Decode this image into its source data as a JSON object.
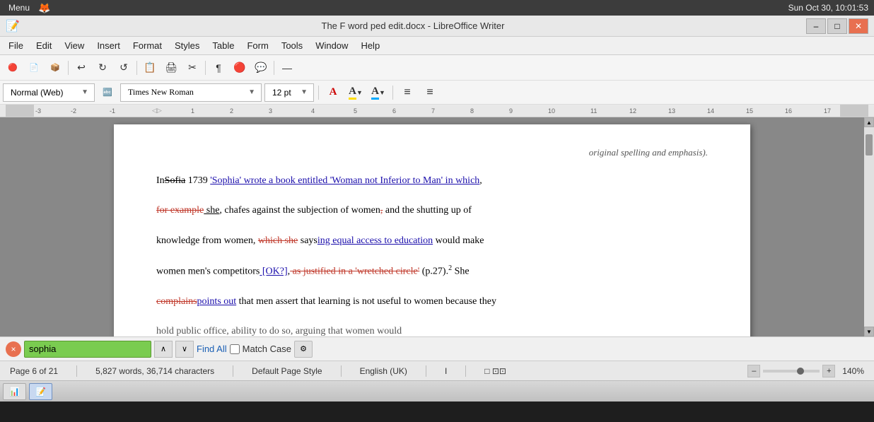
{
  "system": {
    "left_label": "Menu",
    "time": "Sun Oct 30, 10:01:53"
  },
  "window": {
    "title": "The F word ped edit.docx - LibreOffice Writer",
    "min_btn": "–",
    "max_btn": "□",
    "close_btn": "✕"
  },
  "menubar": {
    "items": [
      "File",
      "Edit",
      "View",
      "Insert",
      "Format",
      "Styles",
      "Table",
      "Form",
      "Tools",
      "Window",
      "Help"
    ]
  },
  "toolbar": {
    "buttons": [
      "🔴Z",
      "📄Z",
      "📦Z",
      "↩Z",
      "↻Z",
      "↺Z",
      "📋",
      "🖨",
      "✂",
      "¶",
      "🔴",
      "💬",
      "—"
    ]
  },
  "format_toolbar": {
    "style": "Normal (Web)",
    "font": "Times New Roman",
    "size": "12 pt",
    "font_color_icon": "A",
    "highlight_icon": "A",
    "align_left_icon": "≡",
    "align_right_icon": "≡"
  },
  "document": {
    "content_before": "original spelling and emphasis).",
    "paragraph1_parts": [
      {
        "text": "In",
        "style": "normal"
      },
      {
        "text": "Sofia",
        "style": "strikethrough"
      },
      {
        "text": " 1739 ",
        "style": "normal"
      },
      {
        "text": "'Sophia' wrote a book entitled 'Woman not Inferior to Man' in which",
        "style": "blue-underline"
      },
      {
        "text": ",",
        "style": "normal"
      }
    ],
    "paragraph2_parts": [
      {
        "text": "for example",
        "style": "deleted-red"
      },
      {
        "text": " she",
        "style": "underline"
      },
      {
        "text": ", chafes against the subjection of women",
        "style": "normal"
      },
      {
        "text": ",",
        "style": "deleted-red"
      },
      {
        "text": " and the shutting up of",
        "style": "normal"
      }
    ],
    "paragraph3_parts": [
      {
        "text": "knowledge from women, ",
        "style": "normal"
      },
      {
        "text": "which she",
        "style": "deleted-red"
      },
      {
        "text": " says",
        "style": "normal"
      },
      {
        "text": "ing equal access to education",
        "style": "blue-underline"
      },
      {
        "text": " would make",
        "style": "normal"
      }
    ],
    "paragraph4_parts": [
      {
        "text": "women men's competitors",
        "style": "normal"
      },
      {
        "text": " [OK?]",
        "style": "blue-underline"
      },
      {
        "text": ",",
        "style": "normal"
      },
      {
        "text": " as justified in a 'wretched circle'",
        "style": "deleted-red"
      },
      {
        "text": " (p.27).",
        "style": "normal"
      },
      {
        "text": "2",
        "style": "superscript"
      },
      {
        "text": " She",
        "style": "normal"
      }
    ],
    "paragraph5_parts": [
      {
        "text": "complains",
        "style": "deleted-red"
      },
      {
        "text": "points out",
        "style": "blue-underline"
      },
      {
        "text": " that men assert that learning is not useful to women because they",
        "style": "normal"
      }
    ],
    "paragraph6_text": "hold public office, ability to do so, arguing that women would"
  },
  "findbar": {
    "search_text": "sophia",
    "find_all_label": "Find All",
    "match_case_label": "Match Case",
    "close_icon": "×",
    "prev_icon": "∧",
    "next_icon": "∨",
    "other_icon": "⚙"
  },
  "statusbar": {
    "page_info": "Page 6 of 21",
    "word_count": "5,827 words, 36,714 characters",
    "page_style": "Default Page Style",
    "language": "English (UK)",
    "cursor_pos": "I",
    "doc_state": "□ ⊡⊡",
    "zoom_level": "140%",
    "of_21": "of 21 Page"
  },
  "taskbar": {
    "calc_icon": "📊",
    "writer_icon": "📝"
  }
}
